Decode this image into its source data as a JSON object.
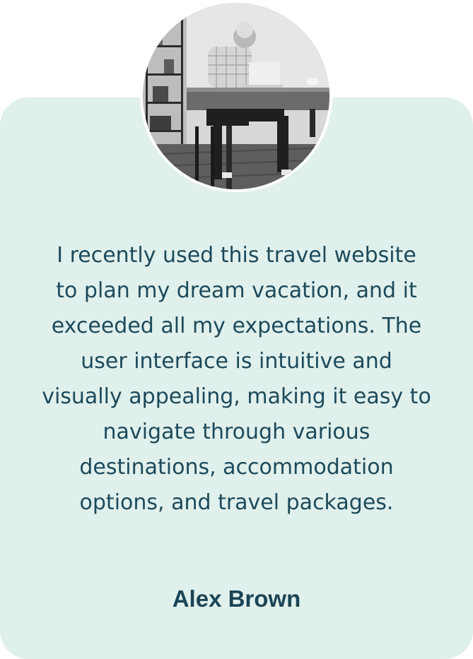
{
  "testimonial": {
    "quote": "I recently used this travel website\nto plan my dream vacation, and it\nexceeded all my expectations. The\nuser interface is intuitive and\nvisually appealing, making it easy to\nnavigate through various\ndestinations, accommodation\noptions, and travel packages.",
    "author": "Alex Brown",
    "photo_icon": "man-working-on-laptop-photo"
  },
  "colors": {
    "card_background": "#e0f0ec",
    "text": "#1d4a5b",
    "author_text": "#1b4556",
    "avatar_border": "#ffffff"
  }
}
